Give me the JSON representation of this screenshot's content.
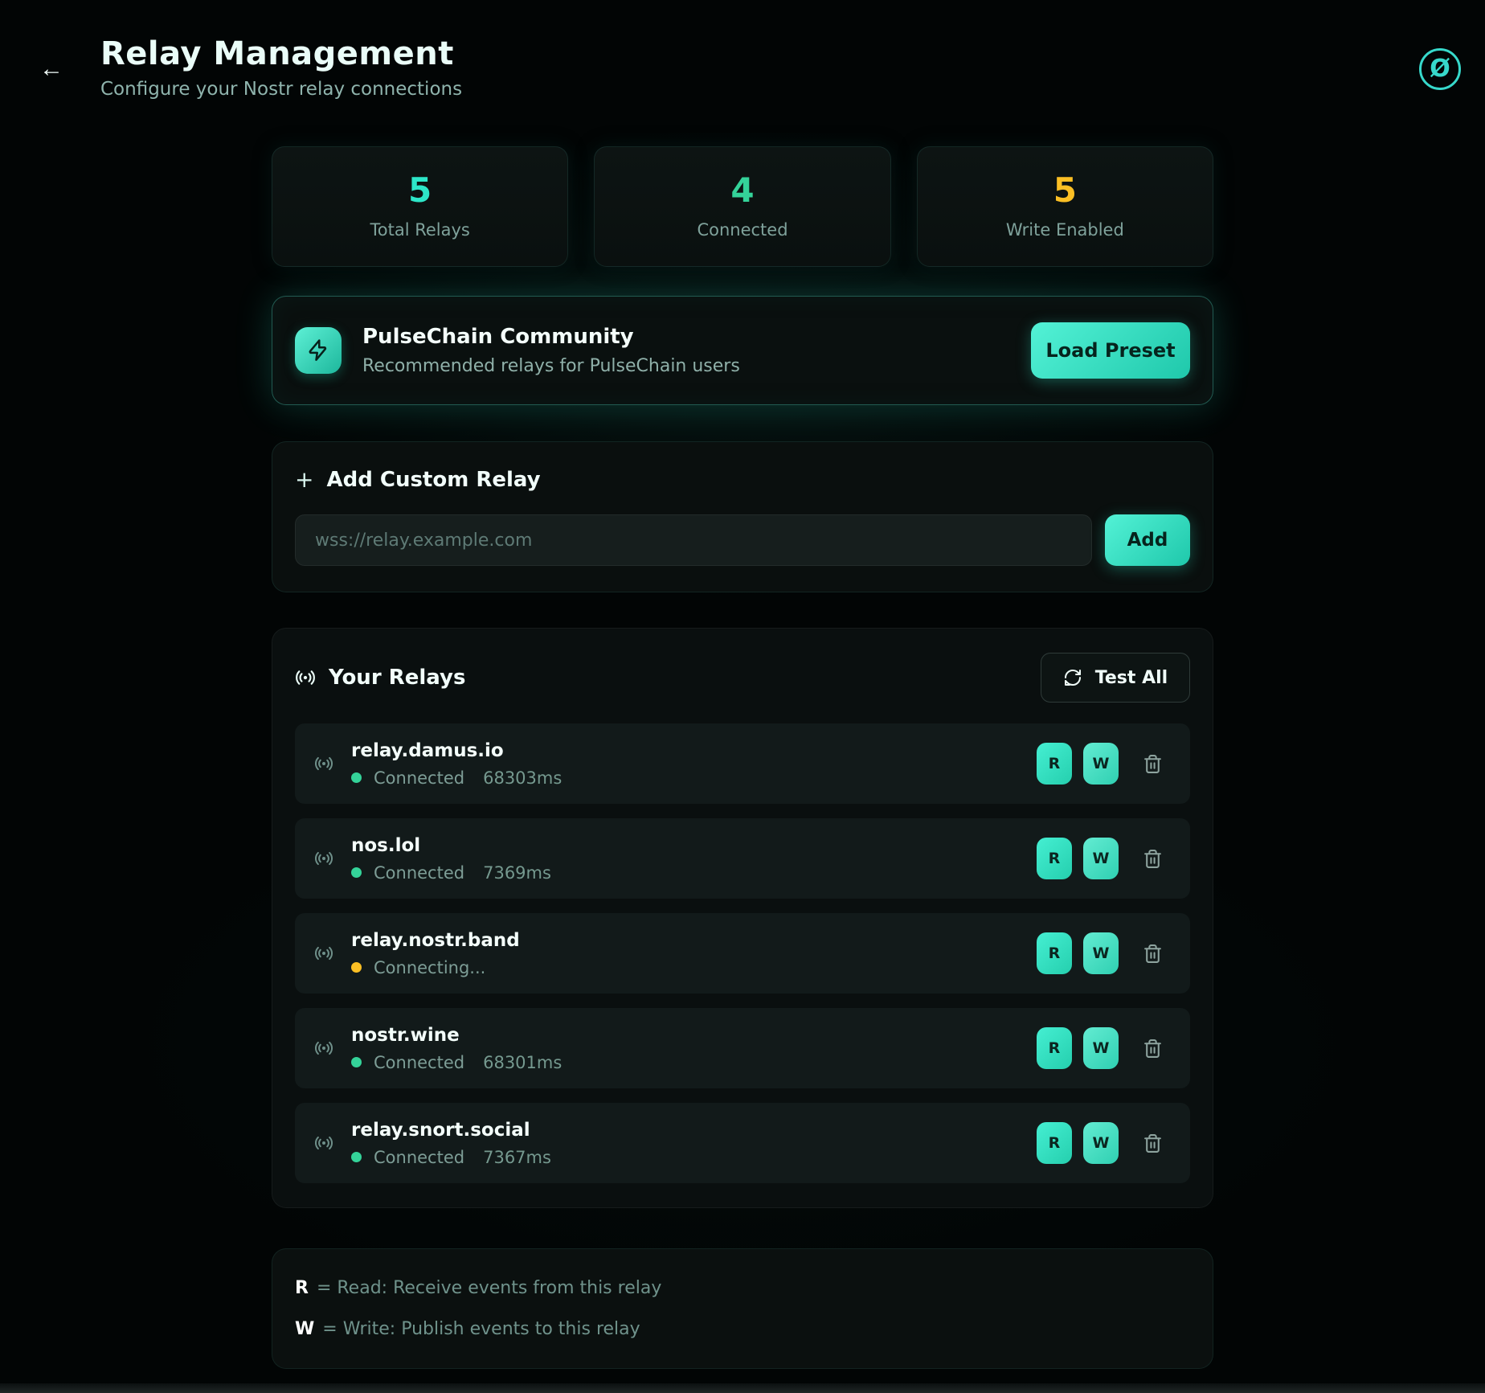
{
  "header": {
    "title": "Relay Management",
    "subtitle": "Configure your Nostr relay connections",
    "back_glyph": "←",
    "logo_glyph": "Ø"
  },
  "stats": [
    {
      "value": "5",
      "label": "Total Relays",
      "color": "#2de6c8"
    },
    {
      "value": "4",
      "label": "Connected",
      "color": "#34d399"
    },
    {
      "value": "5",
      "label": "Write Enabled",
      "color": "#fbbf24"
    }
  ],
  "preset": {
    "title": "PulseChain Community",
    "description": "Recommended relays for PulseChain users",
    "button_label": "Load Preset",
    "icon": "lightning-bolt-icon"
  },
  "add_relay": {
    "plus_glyph": "+",
    "heading": "Add Custom Relay",
    "placeholder": "wss://relay.example.com",
    "button_label": "Add"
  },
  "relays": {
    "heading": "Your Relays",
    "test_all_label": "Test All",
    "read_label": "R",
    "write_label": "W",
    "items": [
      {
        "name": "relay.damus.io",
        "status": "Connected",
        "latency": "68303ms",
        "status_kind": "connected"
      },
      {
        "name": "nos.lol",
        "status": "Connected",
        "latency": "7369ms",
        "status_kind": "connected"
      },
      {
        "name": "relay.nostr.band",
        "status": "Connecting...",
        "latency": "",
        "status_kind": "connecting"
      },
      {
        "name": "nostr.wine",
        "status": "Connected",
        "latency": "68301ms",
        "status_kind": "connected"
      },
      {
        "name": "relay.snort.social",
        "status": "Connected",
        "latency": "7367ms",
        "status_kind": "connected"
      }
    ]
  },
  "legend": {
    "rows": [
      {
        "key": "R",
        "text": "= Read: Receive events from this relay"
      },
      {
        "key": "W",
        "text": "= Write: Publish events to this relay"
      }
    ]
  },
  "colors": {
    "accent": "#2de6c8",
    "connected_dot": "#34d399",
    "connecting_dot": "#fbbf24",
    "write_enabled": "#fbbf24",
    "button_gradient_start": "#53f2d6",
    "button_gradient_end": "#1fc8ab"
  }
}
